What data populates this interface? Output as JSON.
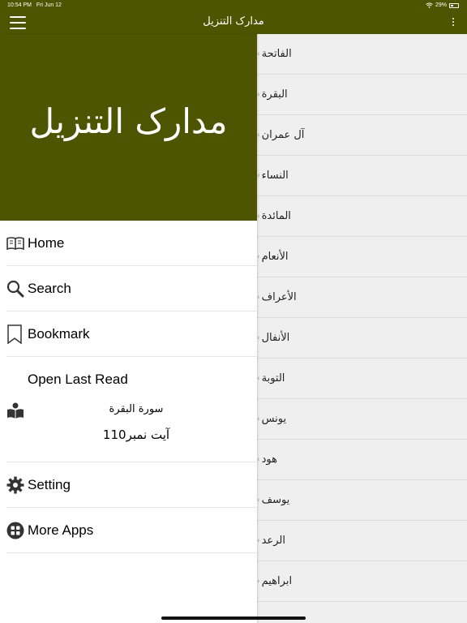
{
  "status": {
    "time": "10:54 PM",
    "date": "Fri Jun 12",
    "battery": "29%"
  },
  "topbar": {
    "title": "مدارک التنزیل"
  },
  "drawer": {
    "brand": "مدارک التنزیل",
    "menu": [
      {
        "label": "Home",
        "icon": "book-icon"
      },
      {
        "label": "Search",
        "icon": "search-icon"
      },
      {
        "label": "Bookmark",
        "icon": "bookmark-icon"
      }
    ],
    "last_read": {
      "label": "Open Last Read",
      "surah": "سورة البقرة",
      "ayah": "آیت نمبر110"
    },
    "menu2": [
      {
        "label": "Setting",
        "icon": "gear-icon"
      },
      {
        "label": "More Apps",
        "icon": "apps-icon"
      }
    ]
  },
  "surahs": [
    "الفاتحة",
    "البقرة",
    "آل عمران",
    "النساء",
    "المائدة",
    "الأنعام",
    "الأعراف",
    "الأنفال",
    "التوبة",
    "يونس",
    "هود",
    "يوسف",
    "الرعد",
    "ابراهيم"
  ],
  "colors": {
    "header": "#4d5500",
    "list_bg": "#efefef"
  }
}
